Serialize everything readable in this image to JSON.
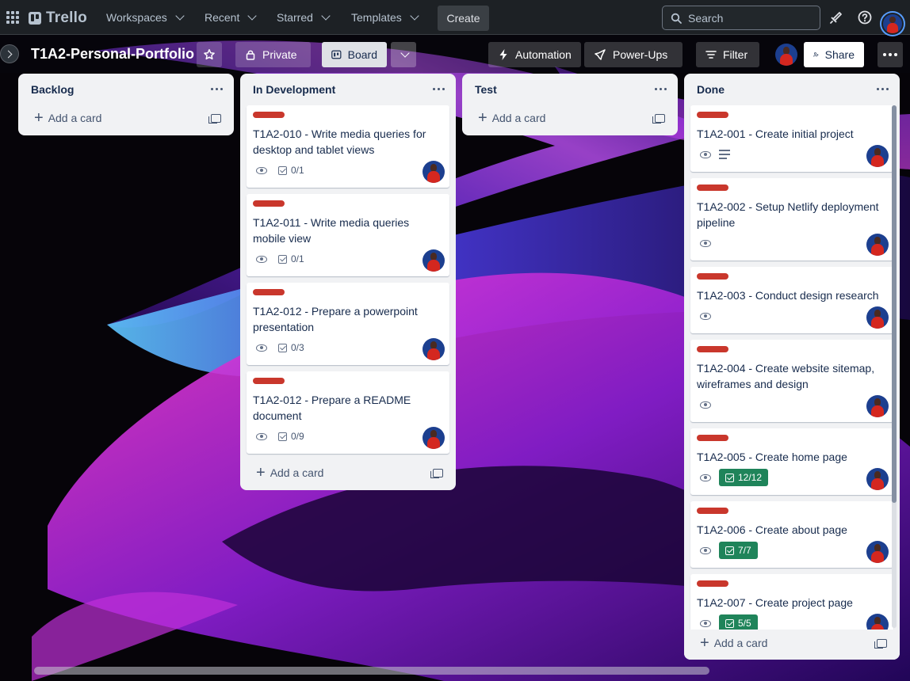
{
  "nav": {
    "logo": "Trello",
    "workspaces": "Workspaces",
    "recent": "Recent",
    "starred": "Starred",
    "templates": "Templates",
    "create": "Create",
    "search_placeholder": "Search"
  },
  "board": {
    "title": "T1A2-Personal-Portfolio",
    "visibility": "Private",
    "view": "Board",
    "automation": "Automation",
    "powerups": "Power-Ups",
    "filter": "Filter",
    "share": "Share"
  },
  "lists": [
    {
      "title": "Backlog",
      "add_card": "Add a card",
      "cards": []
    },
    {
      "title": "In Development",
      "add_card": "Add a card",
      "cards": [
        {
          "title": "T1A2-010 - Write media queries for desktop and tablet views",
          "checklist": "0/1"
        },
        {
          "title": "T1A2-011 - Write media queries mobile view",
          "checklist": "0/1"
        },
        {
          "title": "T1A2-012 - Prepare a powerpoint presentation",
          "checklist": "0/3"
        },
        {
          "title": "T1A2-012 - Prepare a README document",
          "checklist": "0/9"
        }
      ]
    },
    {
      "title": "Test",
      "add_card": "Add a card",
      "cards": []
    },
    {
      "title": "Done",
      "add_card": "Add a card",
      "cards": [
        {
          "title": "T1A2-001 - Create initial project",
          "description": true
        },
        {
          "title": "T1A2-002 - Setup Netlify deployment pipeline"
        },
        {
          "title": "T1A2-003 - Conduct design research"
        },
        {
          "title": "T1A2-004 - Create website sitemap, wireframes and design"
        },
        {
          "title": "T1A2-005 - Create home page",
          "checklist": "12/12"
        },
        {
          "title": "T1A2-006 - Create about page",
          "checklist": "7/7"
        },
        {
          "title": "T1A2-007 - Create project page",
          "checklist": "5/5"
        }
      ]
    }
  ],
  "colors": {
    "label": "#c9372c",
    "checklist_complete": "#1f845a",
    "list_bg": "#f1f2f4",
    "nav_bg": "#1d2125"
  }
}
